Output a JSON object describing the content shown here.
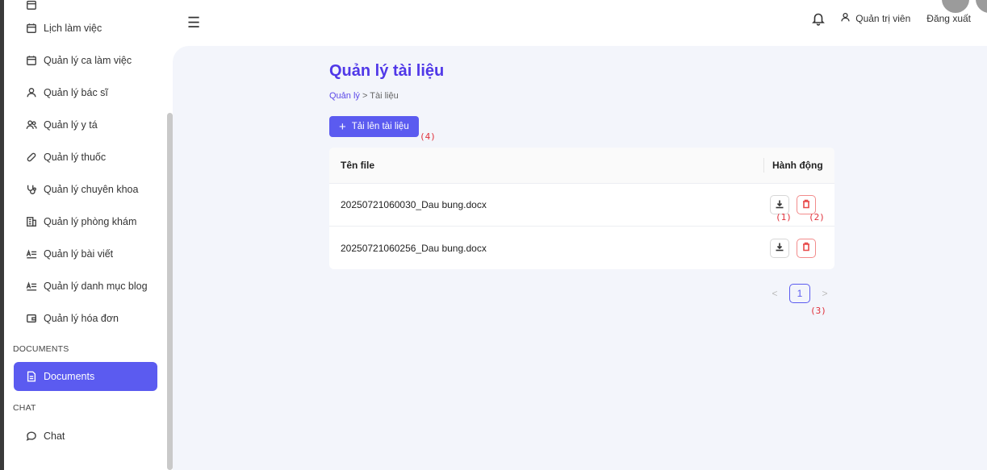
{
  "sidebar": {
    "items": [
      {
        "label": "Lịch làm việc",
        "icon": "calendar-icon"
      },
      {
        "label": "Quản lý ca làm việc",
        "icon": "calendar-icon"
      },
      {
        "label": "Quản lý bác sĩ",
        "icon": "user-icon"
      },
      {
        "label": "Quản lý y tá",
        "icon": "users-icon"
      },
      {
        "label": "Quản lý thuốc",
        "icon": "pill-icon"
      },
      {
        "label": "Quản lý chuyên khoa",
        "icon": "stethoscope-icon"
      },
      {
        "label": "Quản lý phòng khám",
        "icon": "building-icon"
      },
      {
        "label": "Quản lý bài viết",
        "icon": "text-icon"
      },
      {
        "label": "Quản lý danh mục blog",
        "icon": "text-icon"
      },
      {
        "label": "Quản lý hóa đơn",
        "icon": "wallet-icon"
      }
    ],
    "section_documents": "DOCUMENTS",
    "documents_item": "Documents",
    "section_chat": "CHAT",
    "chat_item": "Chat"
  },
  "header": {
    "user": "Quản trị viên",
    "logout": "Đăng xuất"
  },
  "page": {
    "title": "Quản lý tài liệu",
    "breadcrumb_parent": "Quản lý",
    "breadcrumb_sep": ">",
    "breadcrumb_current": "Tài liệu",
    "upload_button": "Tải lên tài liệu"
  },
  "table": {
    "col_name": "Tên file",
    "col_action": "Hành động",
    "rows": [
      {
        "file": "20250721060030_Dau bung.docx"
      },
      {
        "file": "20250721060256_Dau bung.docx"
      }
    ]
  },
  "pagination": {
    "prev": "<",
    "current": "1",
    "next": ">"
  },
  "annotations": {
    "a1": "(1)",
    "a2": "(2)",
    "a3": "(3)",
    "a4": "(4)"
  },
  "colors": {
    "accent": "#5b5bf0",
    "title": "#5038e8",
    "danger": "#e84a4a",
    "annotation": "#e0303a"
  }
}
